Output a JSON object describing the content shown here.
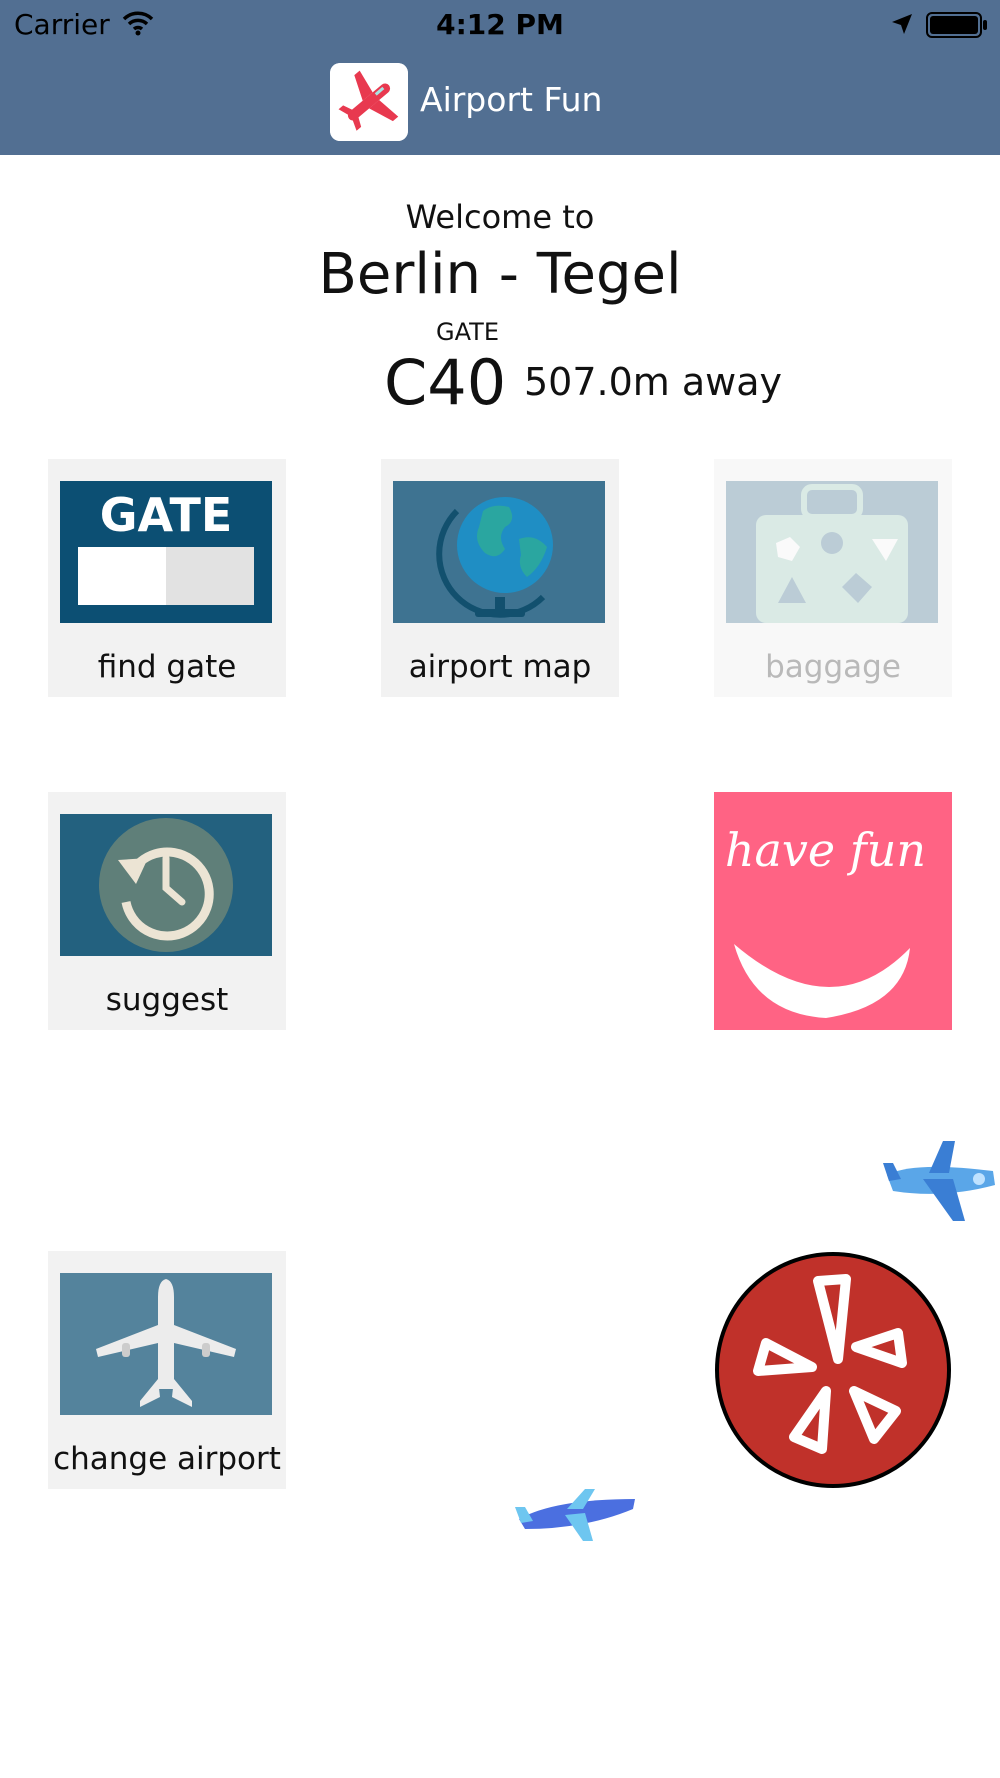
{
  "status_bar": {
    "carrier": "Carrier",
    "time": "4:12 PM"
  },
  "nav": {
    "app_title": "Airport Fun",
    "app_icon": "red-airplane-icon",
    "bar_color": "#526f92"
  },
  "welcome": {
    "intro": "Welcome to",
    "airport_name": "Berlin - Tegel",
    "gate_label": "GATE",
    "gate_value": "C40",
    "distance": "507.0m away"
  },
  "tiles": [
    {
      "label": "find gate",
      "icon": "gate-sign-icon",
      "image_text": "GATE",
      "enabled": true
    },
    {
      "label": "airport map",
      "icon": "globe-icon",
      "enabled": true
    },
    {
      "label": "baggage",
      "icon": "suitcase-icon",
      "enabled": false
    },
    {
      "label": "suggest",
      "icon": "history-clock-icon",
      "enabled": true
    },
    {
      "label": "change airport",
      "icon": "airplane-icon",
      "enabled": true
    }
  ],
  "promo": {
    "have_fun_text": "have fun",
    "have_fun_color": "#ff6384",
    "yelp_icon": "yelp-icon",
    "yelp_color": "#c8312a"
  }
}
